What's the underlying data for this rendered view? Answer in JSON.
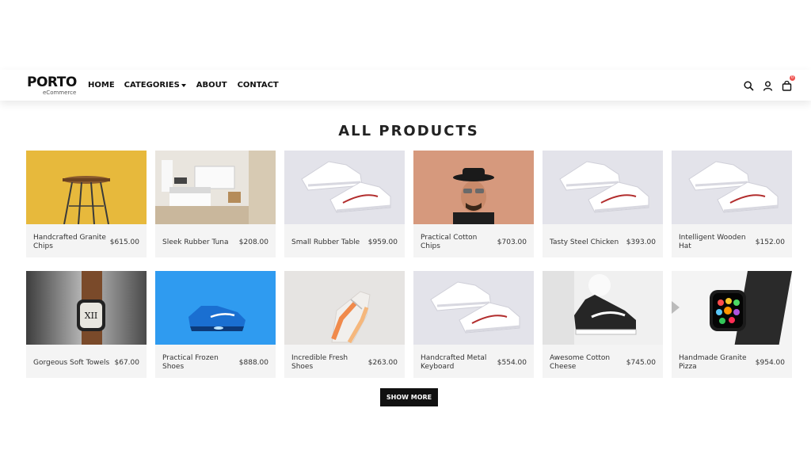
{
  "logo": {
    "name": "PORTO",
    "tagline": "eCommerce"
  },
  "nav": {
    "home": "HOME",
    "categories": "CATEGORIES",
    "about": "ABOUT",
    "contact": "CONTACT"
  },
  "header_icons": [
    "search-icon",
    "user-icon",
    "cart-icon"
  ],
  "cart_count": "0",
  "title": "ALL PRODUCTS",
  "products": [
    {
      "name": "Handcrafted Granite Chips",
      "price": "$615.00",
      "image": "stool"
    },
    {
      "name": "Sleek Rubber Tuna",
      "price": "$208.00",
      "image": "bedroom"
    },
    {
      "name": "Small Rubber Table",
      "price": "$959.00",
      "image": "white-sneakers"
    },
    {
      "name": "Practical Cotton Chips",
      "price": "$703.00",
      "image": "man-hat"
    },
    {
      "name": "Tasty Steel Chicken",
      "price": "$393.00",
      "image": "white-sneakers"
    },
    {
      "name": "Intelligent Wooden Hat",
      "price": "$152.00",
      "image": "white-sneakers"
    },
    {
      "name": "Gorgeous Soft Towels",
      "price": "$67.00",
      "image": "watch"
    },
    {
      "name": "Practical Frozen Shoes",
      "price": "$888.00",
      "image": "blue-sneaker"
    },
    {
      "name": "Incredible Fresh Shoes",
      "price": "$263.00",
      "image": "orange-sneaker"
    },
    {
      "name": "Handcrafted Metal Keyboard",
      "price": "$554.00",
      "image": "white-sneakers"
    },
    {
      "name": "Awesome Cotton Cheese",
      "price": "$745.00",
      "image": "black-sneaker"
    },
    {
      "name": "Handmade Granite Pizza",
      "price": "$954.00",
      "image": "smartwatch"
    }
  ],
  "show_more": "SHOW MORE"
}
